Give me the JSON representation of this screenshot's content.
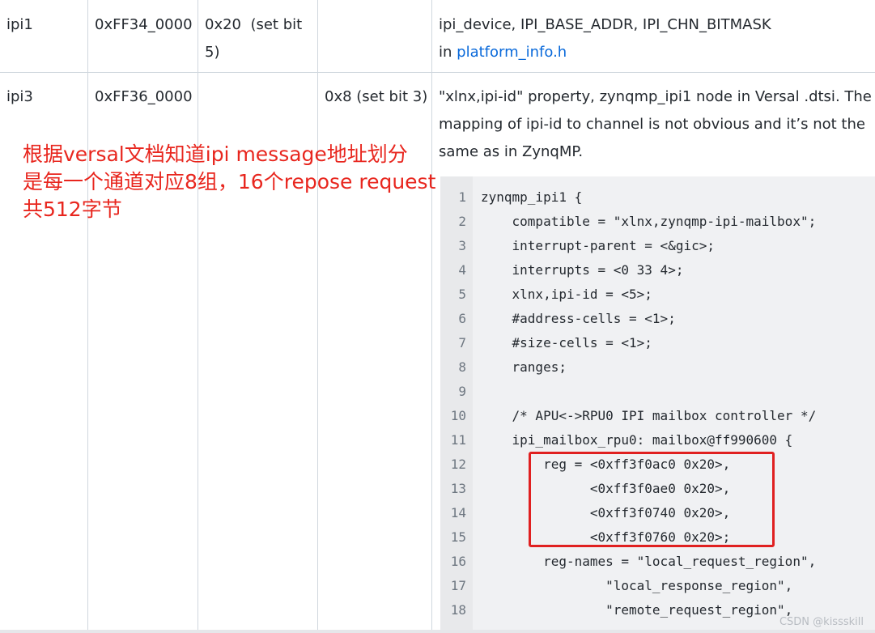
{
  "table": {
    "rows": [
      {
        "name": "ipi1",
        "address": "0xFF34_0000",
        "col3": "0x20  (set bit",
        "col3_b": "5)",
        "col4": "",
        "desc_line1": "ipi_device, IPI_BASE_ADDR, IPI_CHN_BITMASK",
        "desc_line2_prefix": "in ",
        "desc_link": "platform_info.h"
      },
      {
        "name": "ipi3",
        "address": "0xFF36_0000",
        "col3": "",
        "col4": "0x8 (set bit 3)",
        "desc_lines": [
          "\"xlnx,ipi-id\" property, zynqmp_ipi1 node in Versal .dtsi. The",
          "mapping of ipi-id to channel is not obvious and it’s not the",
          "same as in ZynqMP."
        ]
      }
    ]
  },
  "code": {
    "line_numbers": [
      "1",
      "2",
      "3",
      "4",
      "5",
      "6",
      "7",
      "8",
      "9",
      "10",
      "11",
      "12",
      "13",
      "14",
      "15",
      "16",
      "17",
      "18"
    ],
    "lines": [
      "zynqmp_ipi1 {",
      "    compatible = \"xlnx,zynqmp-ipi-mailbox\";",
      "    interrupt-parent = <&gic>;",
      "    interrupts = <0 33 4>;",
      "    xlnx,ipi-id = <5>;",
      "    #address-cells = <1>;",
      "    #size-cells = <1>;",
      "    ranges;",
      "",
      "    /* APU<->RPU0 IPI mailbox controller */",
      "    ipi_mailbox_rpu0: mailbox@ff990600 {",
      "        reg = <0xff3f0ac0 0x20>,",
      "              <0xff3f0ae0 0x20>,",
      "              <0xff3f0740 0x20>,",
      "              <0xff3f0760 0x20>;",
      "        reg-names = \"local_request_region\",",
      "                \"local_response_region\",",
      "                \"remote_request_region\","
    ]
  },
  "annotation": {
    "lines": [
      "根据versal文档知道ipi message地址划分",
      "是每一个通道对应8组，16个repose request",
      "共512字节"
    ],
    "color": "#e8261e"
  },
  "watermark": "CSDN @kissskill"
}
